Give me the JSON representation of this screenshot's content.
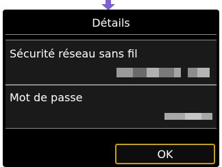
{
  "header": {
    "title": "Détails"
  },
  "fields": [
    {
      "label": "Sécurité réseau sans fil"
    },
    {
      "label": "Mot de passe"
    }
  ],
  "footer": {
    "ok_label": "OK"
  },
  "colors": {
    "screen_bg": "#000000",
    "panel_bg": "#1a1a1a",
    "ok_border": "#c9a000",
    "arrow": "#7c5fd0"
  },
  "icons": {
    "scroll_indicator": "arrow-down-icon"
  }
}
